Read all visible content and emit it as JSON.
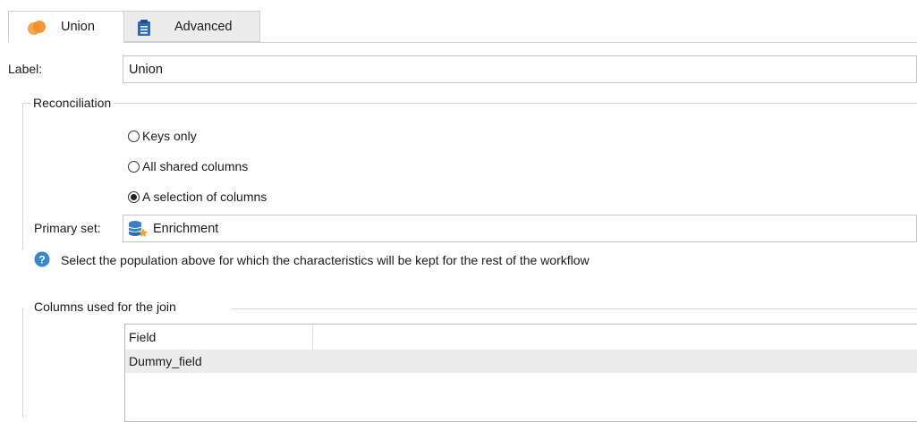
{
  "tabs": [
    {
      "label": "Union",
      "icon": "union-circles-icon",
      "active": true
    },
    {
      "label": "Advanced",
      "icon": "clipboard-icon",
      "active": false
    }
  ],
  "form": {
    "label_caption": "Label:",
    "label_value": "Union"
  },
  "reconciliation": {
    "title": "Reconciliation",
    "options": [
      {
        "label": "Keys only",
        "checked": false
      },
      {
        "label": "All shared columns",
        "checked": false
      },
      {
        "label": "A selection of columns",
        "checked": true
      }
    ],
    "primary_set_caption": "Primary set:",
    "primary_set_value": "Enrichment",
    "primary_set_icon": "database-enrichment-icon",
    "help_text": "Select the population above for which the characteristics will be kept for the rest of the workflow",
    "help_icon": "question-icon"
  },
  "join_columns": {
    "title": "Columns used for the join",
    "headers": [
      "Field",
      ""
    ],
    "rows": [
      {
        "field": "Dummy_field",
        "selected": true
      }
    ]
  },
  "colors": {
    "union_icon": "#f28c28",
    "clipboard_icon": "#2b6cb8",
    "help_icon": "#3a86c8",
    "selected_row": "#ececec"
  }
}
